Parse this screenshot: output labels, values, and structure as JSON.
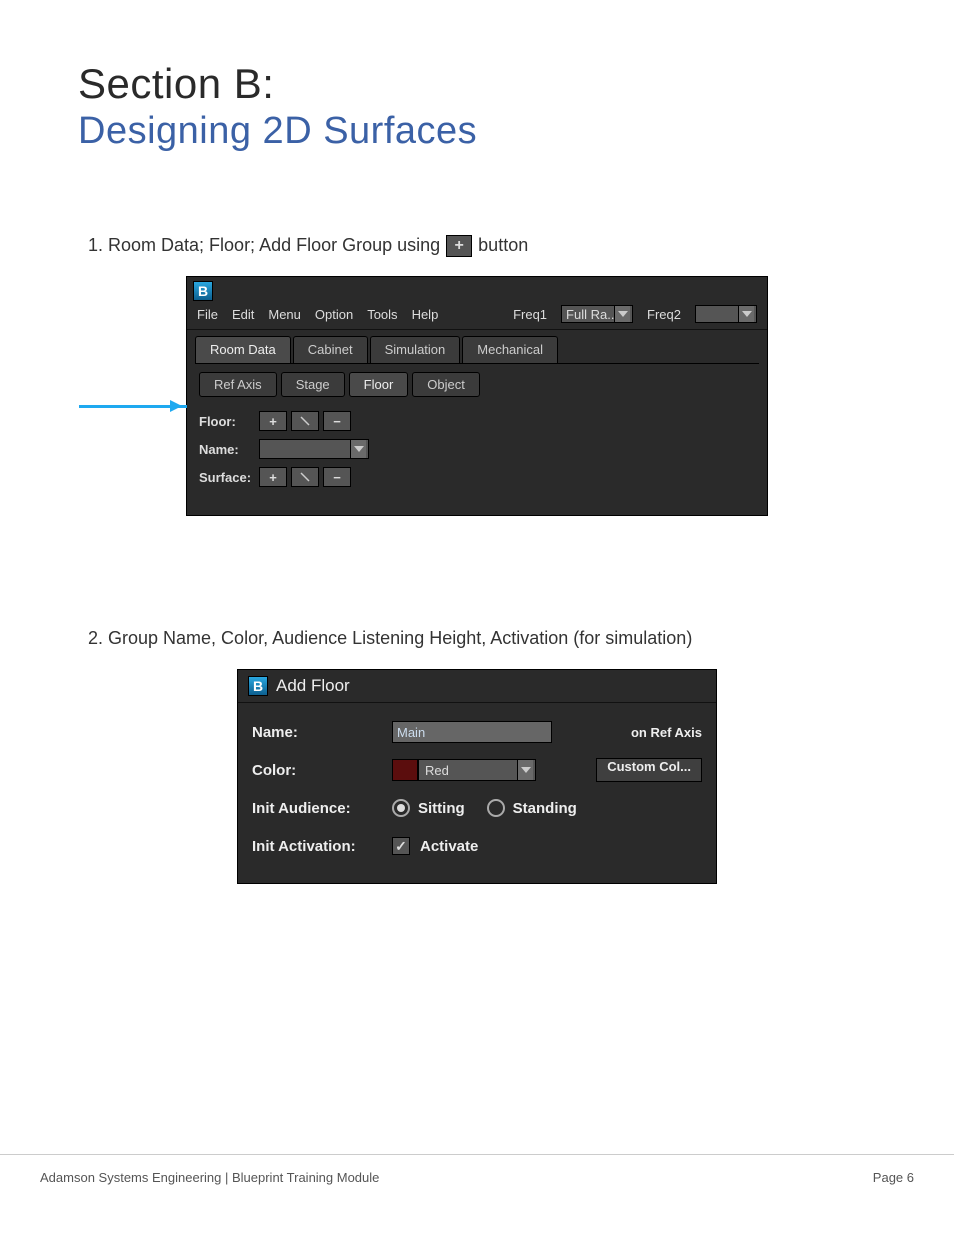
{
  "heading": {
    "section_label": "Section B:",
    "title": "Designing 2D Surfaces"
  },
  "step1": {
    "prefix": "1. Room Data; Floor; Add Floor Group using",
    "suffix": "button",
    "inline_plus_glyph": "+"
  },
  "main_ui": {
    "logo_glyph": "B",
    "menubar": [
      "File",
      "Edit",
      "Menu",
      "Option",
      "Tools",
      "Help"
    ],
    "freq1_label": "Freq1",
    "freq1_value": "Full Ra...",
    "freq2_label": "Freq2",
    "tabs": [
      "Room Data",
      "Cabinet",
      "Simulation",
      "Mechanical"
    ],
    "active_tab": "Room Data",
    "subtabs": [
      "Ref Axis",
      "Stage",
      "Floor",
      "Object"
    ],
    "active_subtab": "Floor",
    "form": {
      "floor_label": "Floor:",
      "name_label": "Name:",
      "surface_label": "Surface:",
      "plus_glyph": "+",
      "slash_glyph": "\\",
      "minus_glyph": "−"
    }
  },
  "step2": {
    "text": "2. Group Name, Color, Audience Listening Height, Activation (for simulation)"
  },
  "dialog": {
    "logo_glyph": "B",
    "title": "Add Floor",
    "name_label": "Name:",
    "name_value": "Main",
    "name_suffix": "on Ref Axis",
    "color_label": "Color:",
    "color_value": "Red",
    "custom_color_btn": "Custom Col...",
    "audience_label": "Init Audience:",
    "audience_options": [
      "Sitting",
      "Standing"
    ],
    "audience_selected": "Sitting",
    "activation_label": "Init Activation:",
    "activation_text": "Activate",
    "activation_checked": true
  },
  "footer": {
    "left": "Adamson Systems Engineering  |  Blueprint Training Module",
    "right": "Page 6"
  }
}
